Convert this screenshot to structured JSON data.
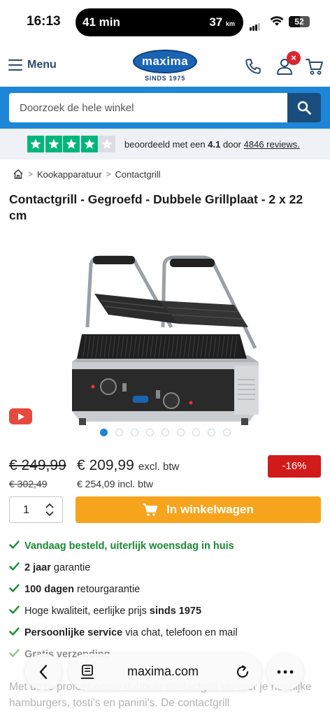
{
  "status_bar": {
    "time": "16:13",
    "activity_left": "41 min",
    "activity_right": "37",
    "activity_unit": "km",
    "battery": "52"
  },
  "header": {
    "menu_label": "Menu",
    "logo_text": "maxima",
    "logo_since": "SINDS 1975",
    "cart_badge": "×"
  },
  "search": {
    "placeholder": "Doorzoek de hele winkel"
  },
  "rating": {
    "score": 4.1,
    "stars_total": 5,
    "stars_filled": 4,
    "text_prefix": "beoordeeld met een",
    "score_label": "4.1",
    "text_mid": "door",
    "reviews_link": "4846 reviews."
  },
  "breadcrumb": {
    "items": [
      "Kookapparatuur",
      "Contactgrill"
    ]
  },
  "product": {
    "title": "Contactgrill - Gegroefd - Dubbele Grillplaat - 2 x 22 cm",
    "image_count": 9,
    "active_image": 1,
    "old_price": "€ 249,99",
    "old_price_incl": "€ 302,49",
    "price": "€ 209,99",
    "price_suffix": "excl. btw",
    "price_incl": "€ 254,09 incl. btw",
    "discount": "-16%",
    "quantity": "1",
    "cart_button": "In winkelwagen"
  },
  "usps": [
    {
      "bold": "Vandaag besteld, uiterlijk woensdag in huis",
      "rest": "",
      "green": true
    },
    {
      "bold": "2 jaar",
      "rest": " garantie",
      "green": false
    },
    {
      "bold": "100 dagen",
      "rest": " retourgarantie",
      "green": false
    },
    {
      "pre": "Hoge kwaliteit, eerlijke prijs ",
      "bold": "sinds 1975",
      "rest": "",
      "green": false
    },
    {
      "bold": "Persoonlijke service",
      "rest": " via chat, telefoon en mail",
      "green": false
    },
    {
      "bold": "Gratis verzending",
      "rest": "",
      "green": false
    }
  ],
  "description": "Met deze professionele dubbele contactgrill serveer je heerlijke hamburgers, tosti's en panini's. De contactgrill",
  "browser": {
    "url": "maxima.com"
  },
  "colors": {
    "brand_blue": "#1e86d6",
    "dark_blue": "#1a4d7e",
    "cart_orange": "#f7a41d",
    "discount_red": "#d11b1b",
    "trust_green": "#00b67a",
    "usp_green": "#178a33"
  }
}
